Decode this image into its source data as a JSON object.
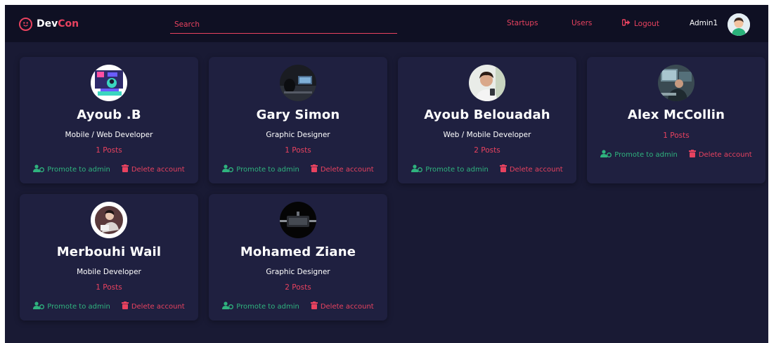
{
  "navbar": {
    "brand_dev": "Dev",
    "brand_con": "Con",
    "search_placeholder": "Search",
    "links": {
      "startups": "Startups",
      "users": "Users",
      "logout": "Logout"
    },
    "user_name": "Admin1"
  },
  "colors": {
    "accent": "#e8425f",
    "success": "#2fb37e",
    "background": "#191a34",
    "card": "#1f2040",
    "navbar": "#0f1023"
  },
  "cards": [
    {
      "name": "Ayoub .B",
      "role": "Mobile / Web Developer",
      "posts": "1 Posts",
      "promote": "Promote to admin",
      "delete": "Delete account"
    },
    {
      "name": "Gary Simon",
      "role": "Graphic Designer",
      "posts": "1 Posts",
      "promote": "Promote to admin",
      "delete": "Delete account"
    },
    {
      "name": "Ayoub Belouadah",
      "role": "Web / Mobile Developer",
      "posts": "2 Posts",
      "promote": "Promote to admin",
      "delete": "Delete account"
    },
    {
      "name": "Alex McCollin",
      "role": "",
      "posts": "1 Posts",
      "promote": "Promote to admin",
      "delete": "Delete account"
    },
    {
      "name": "Merbouhi Wail",
      "role": "Mobile Developer",
      "posts": "1 Posts",
      "promote": "Promote to admin",
      "delete": "Delete account"
    },
    {
      "name": "Mohamed Ziane",
      "role": "Graphic Designer",
      "posts": "2 Posts",
      "promote": "Promote to admin",
      "delete": "Delete account"
    }
  ]
}
